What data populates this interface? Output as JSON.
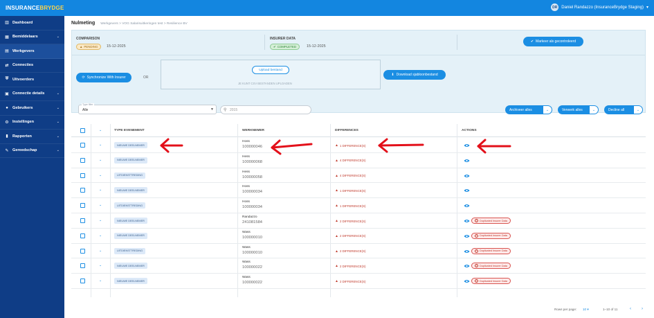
{
  "header": {
    "logo_part1": "INSURANCE",
    "logo_part2": "BRYDGE",
    "user_initials": "DR",
    "user_name": "Daniel Randazzo (InsuranceBrydge Staging)",
    "user_caret": "▾"
  },
  "sidebar": {
    "items": [
      {
        "label": "Dashboard",
        "icon": "▥",
        "has_chevron": false
      },
      {
        "label": "Bemiddelaars",
        "icon": "▦",
        "has_chevron": true
      },
      {
        "label": "Werkgevers",
        "icon": "▤",
        "has_chevron": false
      },
      {
        "label": "Connecties",
        "icon": "⇄",
        "has_chevron": false
      },
      {
        "label": "Uitvoerders",
        "icon": "⛨",
        "has_chevron": false
      },
      {
        "label": "Connectie details",
        "icon": "▣",
        "has_chevron": true
      },
      {
        "label": "Gebruikers",
        "icon": "●",
        "has_chevron": true
      },
      {
        "label": "Instellingen",
        "icon": "⚙",
        "has_chevron": true
      },
      {
        "label": "Rapporten",
        "icon": "▮",
        "has_chevron": true
      },
      {
        "label": "Gereedschap",
        "icon": "✎",
        "has_chevron": true
      }
    ],
    "chevron": "⌄"
  },
  "breadcrumb": {
    "title": "Nulmeting",
    "path": "Werkgevers  >  VOG Salarisuitkeringen test  >  Resilience BV"
  },
  "comparison": {
    "label": "COMPARISON",
    "status": "PENDING",
    "date": "15-12-2025"
  },
  "insurer": {
    "label": "INSURER DATA",
    "status": "COMPLETED",
    "date": "15-12-2025"
  },
  "buttons": {
    "mark_checked": "Markeer als gecontroleerd",
    "sync": "Synchronize With Insurer",
    "or": "OR",
    "upload": "Upload bestand",
    "upload_hint": "JE KUNT CSV BESTANDEN UPLOADEN",
    "download": "Download sjabloonbestand"
  },
  "filters": {
    "type_label": "Type filter",
    "type_value": "Alle",
    "search_value": "2015"
  },
  "actions": {
    "archive_all": "Archiveer alles",
    "process_all": "Verwerk alles",
    "decline_all": "Decline all",
    "dropdown": "⌄"
  },
  "table": {
    "headers": {
      "type": "TYPE EVENEMENT",
      "employee": "WERKNEMER",
      "differences": "DIFFERENCES",
      "actions": "ACTIONS"
    },
    "rows": [
      {
        "type": "NIEUWE DEELNEMER",
        "name": "Hoss",
        "number": "100000046",
        "diff": "1 DIFFERENCE(S)",
        "duplicate": false
      },
      {
        "type": "NIEUWE DEELNEMER",
        "name": "Hess",
        "number": "100000068",
        "diff": "4 DIFFERENCE(S)",
        "duplicate": false
      },
      {
        "type": "UITDIENSTTREDING",
        "name": "Hess",
        "number": "100000058",
        "diff": "4 DIFFERENCE(S)",
        "duplicate": false
      },
      {
        "type": "NIEUWE DEELNEMER",
        "name": "Hoss",
        "number": "100000034",
        "diff": "1 DIFFERENCE(S)",
        "duplicate": false
      },
      {
        "type": "UITDIENSTTREDING",
        "name": "Hoss",
        "number": "100000034",
        "diff": "1 DIFFERENCE(S)",
        "duplicate": false
      },
      {
        "type": "NIEUWE DEELNEMER",
        "name": "Randazzo",
        "number": "241081584",
        "diff": "2 DIFFERENCE(S)",
        "duplicate": true
      },
      {
        "type": "NIEUWE DEELNEMER",
        "name": "Wass",
        "number": "100000010",
        "diff": "2 DIFFERENCE(S)",
        "duplicate": true
      },
      {
        "type": "UITDIENSTTREDING",
        "name": "Wass",
        "number": "100000010",
        "diff": "2 DIFFERENCE(S)",
        "duplicate": true
      },
      {
        "type": "NIEUWE DEELNEMER",
        "name": "Wass",
        "number": "100000022",
        "diff": "2 DIFFERENCE(S)",
        "duplicate": true
      },
      {
        "type": "NIEUWE DEELNEMER",
        "name": "Wass",
        "number": "100000022",
        "diff": "2 DIFFERENCE(S)",
        "duplicate": true
      }
    ],
    "duplicate_label": "Duplicated Insurer Data"
  },
  "pagination": {
    "rows_per_page_label": "Rows per page:",
    "rows_per_page": "10",
    "range": "1–10 of 11",
    "prev": "‹",
    "next": "›"
  },
  "colors": {
    "topbar": "#1386e0",
    "sidebar": "#0f3d86",
    "accent": "#1b8ee3",
    "danger": "#c0392b",
    "annotation_arrow": "#e3101a"
  }
}
